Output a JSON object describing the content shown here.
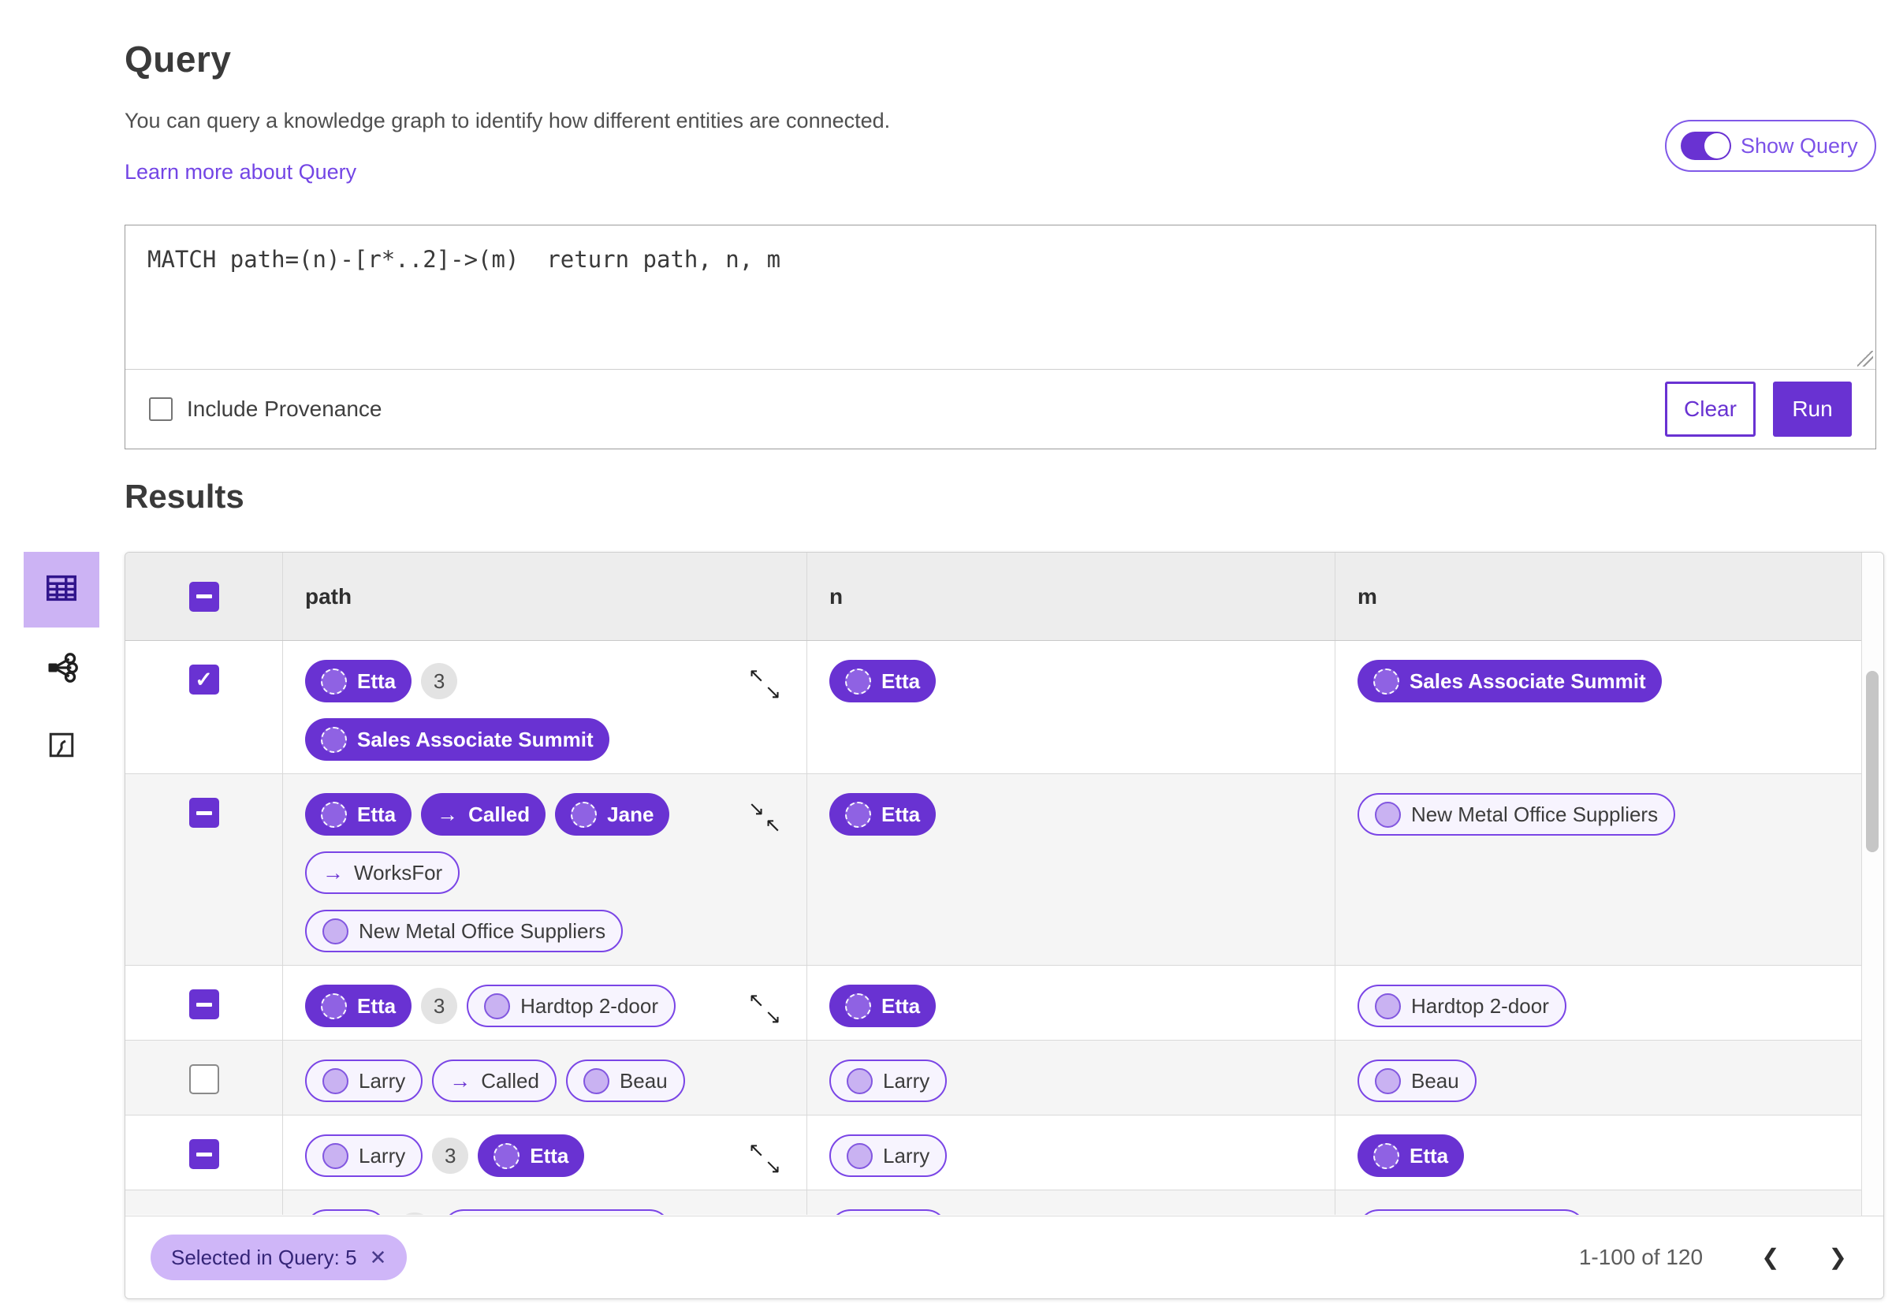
{
  "colors": {
    "accent": "#6932d2",
    "accent_light": "#ccb3f4",
    "link": "#7345e5",
    "chip_bg": "#cfb6f8",
    "chip_text": "#352578",
    "zebra_row": "#f5f5f5",
    "table_header_bg": "#ededed"
  },
  "header": {
    "title": "Query",
    "description": "You can query a knowledge graph to identify how different entities are connected.",
    "learn_more": "Learn more about Query",
    "show_query_label": "Show Query",
    "show_query_on": true
  },
  "query_editor": {
    "query_text": "MATCH path=(n)-[r*..2]->(m)  return path, n, m",
    "include_provenance_label": "Include Provenance",
    "include_provenance_checked": false,
    "clear_label": "Clear",
    "run_label": "Run"
  },
  "results": {
    "title": "Results",
    "view_modes": [
      {
        "name": "table-view",
        "icon": "table-icon",
        "selected": true
      },
      {
        "name": "graph-view",
        "icon": "graph-network-icon",
        "selected": false
      },
      {
        "name": "map-view",
        "icon": "map-icon",
        "selected": false
      }
    ],
    "columns": {
      "path": "path",
      "n": "n",
      "m": "m"
    },
    "header_checkbox": "indeterminate",
    "rows": [
      {
        "checkbox": "checked",
        "corner_icon": "expand",
        "path_items": [
          {
            "type": "node",
            "label": "Etta",
            "variant": "filled"
          },
          {
            "type": "count",
            "label": "3"
          },
          {
            "type": "break"
          },
          {
            "type": "node",
            "label": "Sales Associate Summit",
            "variant": "filled"
          }
        ],
        "n_items": [
          {
            "type": "node",
            "label": "Etta",
            "variant": "filled"
          }
        ],
        "m_items": [
          {
            "type": "node",
            "label": "Sales Associate Summit",
            "variant": "filled"
          }
        ]
      },
      {
        "checkbox": "indeterminate",
        "corner_icon": "collapse",
        "path_items": [
          {
            "type": "node",
            "label": "Etta",
            "variant": "filled"
          },
          {
            "type": "edge",
            "label": "Called",
            "variant": "filled"
          },
          {
            "type": "node",
            "label": "Jane",
            "variant": "filled"
          },
          {
            "type": "break"
          },
          {
            "type": "edge",
            "label": "WorksFor",
            "variant": "outline"
          },
          {
            "type": "break"
          },
          {
            "type": "node",
            "label": "New Metal Office Suppliers",
            "variant": "outline"
          }
        ],
        "n_items": [
          {
            "type": "node",
            "label": "Etta",
            "variant": "filled"
          }
        ],
        "m_items": [
          {
            "type": "node",
            "label": "New Metal Office Suppliers",
            "variant": "outline"
          }
        ]
      },
      {
        "checkbox": "indeterminate",
        "corner_icon": "expand",
        "path_items": [
          {
            "type": "node",
            "label": "Etta",
            "variant": "filled"
          },
          {
            "type": "count",
            "label": "3"
          },
          {
            "type": "node",
            "label": "Hardtop 2-door",
            "variant": "outline"
          }
        ],
        "n_items": [
          {
            "type": "node",
            "label": "Etta",
            "variant": "filled"
          }
        ],
        "m_items": [
          {
            "type": "node",
            "label": "Hardtop 2-door",
            "variant": "outline"
          }
        ]
      },
      {
        "checkbox": "unchecked",
        "corner_icon": null,
        "path_items": [
          {
            "type": "node",
            "label": "Larry",
            "variant": "outline"
          },
          {
            "type": "edge",
            "label": "Called",
            "variant": "outline"
          },
          {
            "type": "node",
            "label": "Beau",
            "variant": "outline"
          }
        ],
        "n_items": [
          {
            "type": "node",
            "label": "Larry",
            "variant": "outline"
          }
        ],
        "m_items": [
          {
            "type": "node",
            "label": "Beau",
            "variant": "outline"
          }
        ]
      },
      {
        "checkbox": "indeterminate",
        "corner_icon": "expand",
        "path_items": [
          {
            "type": "node",
            "label": "Larry",
            "variant": "outline"
          },
          {
            "type": "count",
            "label": "3"
          },
          {
            "type": "node",
            "label": "Etta",
            "variant": "filled"
          }
        ],
        "n_items": [
          {
            "type": "node",
            "label": "Larry",
            "variant": "outline"
          }
        ],
        "m_items": [
          {
            "type": "node",
            "label": "Etta",
            "variant": "filled"
          }
        ]
      },
      {
        "checkbox": "hidden",
        "corner_icon": null,
        "clipped": true,
        "path_items": [
          {
            "type": "node",
            "label": "",
            "variant": "outline",
            "size": "sm"
          },
          {
            "type": "count",
            "label": ""
          },
          {
            "type": "node",
            "label": "",
            "variant": "outline",
            "size": "xl"
          }
        ],
        "n_items": [
          {
            "type": "node",
            "label": "",
            "variant": "outline",
            "size": "md"
          }
        ],
        "m_items": [
          {
            "type": "node",
            "label": "",
            "variant": "outline",
            "size": "xl"
          }
        ]
      }
    ],
    "footer": {
      "selected_chip_label": "Selected in Query: 5",
      "pagination_range": "1-100 of 120"
    }
  }
}
